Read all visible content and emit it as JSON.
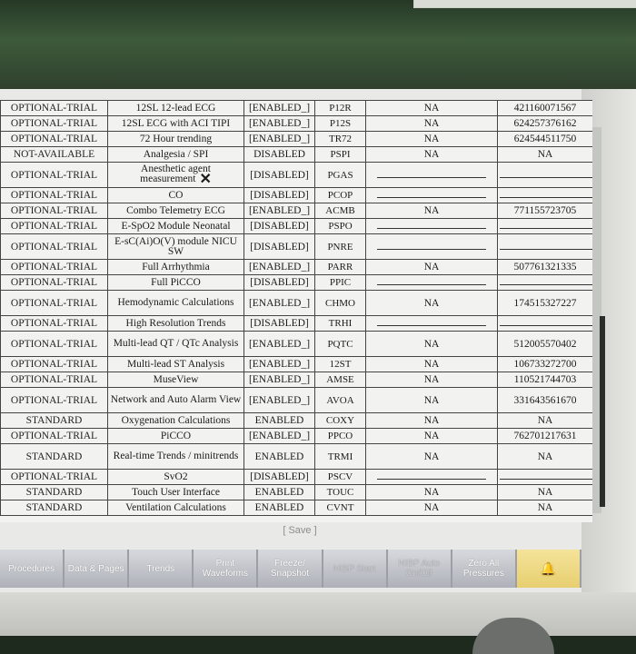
{
  "rows": [
    {
      "status": "OPTIONAL-TRIAL",
      "name": "12SL 12-lead ECG",
      "state": "[ENABLED_]",
      "code": "P12R",
      "na": "NA",
      "key": "421160071567",
      "tall": false
    },
    {
      "status": "OPTIONAL-TRIAL",
      "name": "12SL ECG with ACI TIPI",
      "state": "[ENABLED_]",
      "code": "P12S",
      "na": "NA",
      "key": "624257376162",
      "tall": false
    },
    {
      "status": "OPTIONAL-TRIAL",
      "name": "72 Hour trending",
      "state": "[ENABLED_]",
      "code": "TR72",
      "na": "NA",
      "key": "624544511750",
      "tall": false
    },
    {
      "status": "NOT-AVAILABLE",
      "name": "Analgesia / SPI",
      "state": "DISABLED",
      "code": "PSPI",
      "na": "NA",
      "key": "NA",
      "tall": false
    },
    {
      "status": "OPTIONAL-TRIAL",
      "name": "Anesthetic agent measurement",
      "state": "[DISABLED]",
      "code": "PGAS",
      "na": "",
      "key": "",
      "tall": true,
      "mark": "✕"
    },
    {
      "status": "OPTIONAL-TRIAL",
      "name": "CO",
      "state": "[DISABLED]",
      "code": "PCOP",
      "na": "",
      "key": "",
      "tall": false
    },
    {
      "status": "OPTIONAL-TRIAL",
      "name": "Combo Telemetry ECG",
      "state": "[ENABLED_]",
      "code": "ACMB",
      "na": "NA",
      "key": "771155723705",
      "tall": false
    },
    {
      "status": "OPTIONAL-TRIAL",
      "name": "E-SpO2 Module Neonatal",
      "state": "[DISABLED]",
      "code": "PSPO",
      "na": "",
      "key": "",
      "tall": false
    },
    {
      "status": "OPTIONAL-TRIAL",
      "name": "E-sC(Ai)O(V) module NICU SW",
      "state": "[DISABLED]",
      "code": "PNRE",
      "na": "",
      "key": "",
      "tall": true
    },
    {
      "status": "OPTIONAL-TRIAL",
      "name": "Full Arrhythmia",
      "state": "[ENABLED_]",
      "code": "PARR",
      "na": "NA",
      "key": "507761321335",
      "tall": false
    },
    {
      "status": "OPTIONAL-TRIAL",
      "name": "Full PiCCO",
      "state": "[DISABLED]",
      "code": "PPIC",
      "na": "",
      "key": "",
      "tall": false
    },
    {
      "status": "OPTIONAL-TRIAL",
      "name": "Hemodynamic Calculations",
      "state": "[ENABLED_]",
      "code": "CHMO",
      "na": "NA",
      "key": "174515327227",
      "tall": true
    },
    {
      "status": "OPTIONAL-TRIAL",
      "name": "High Resolution Trends",
      "state": "[DISABLED]",
      "code": "TRHI",
      "na": "",
      "key": "",
      "tall": false
    },
    {
      "status": "OPTIONAL-TRIAL",
      "name": "Multi-lead QT / QTc Analysis",
      "state": "[ENABLED_]",
      "code": "PQTC",
      "na": "NA",
      "key": "512005570402",
      "tall": true
    },
    {
      "status": "OPTIONAL-TRIAL",
      "name": "Multi-lead ST Analysis",
      "state": "[ENABLED_]",
      "code": "12ST",
      "na": "NA",
      "key": "106733272700",
      "tall": false
    },
    {
      "status": "OPTIONAL-TRIAL",
      "name": "MuseView",
      "state": "[ENABLED_]",
      "code": "AMSE",
      "na": "NA",
      "key": "110521744703",
      "tall": false
    },
    {
      "status": "OPTIONAL-TRIAL",
      "name": "Network and Auto Alarm View",
      "state": "[ENABLED_]",
      "code": "AVOA",
      "na": "NA",
      "key": "331643561670",
      "tall": true
    },
    {
      "status": "STANDARD",
      "name": "Oxygenation Calculations",
      "state": "ENABLED",
      "code": "COXY",
      "na": "NA",
      "key": "NA",
      "tall": false
    },
    {
      "status": "OPTIONAL-TRIAL",
      "name": "PiCCO",
      "state": "[ENABLED_]",
      "code": "PPCO",
      "na": "NA",
      "key": "762701217631",
      "tall": false
    },
    {
      "status": "STANDARD",
      "name": "Real-time Trends / minitrends",
      "state": "ENABLED",
      "code": "TRMI",
      "na": "NA",
      "key": "NA",
      "tall": true
    },
    {
      "status": "OPTIONAL-TRIAL",
      "name": "SvO2",
      "state": "[DISABLED]",
      "code": "PSCV",
      "na": "",
      "key": "",
      "tall": false
    },
    {
      "status": "STANDARD",
      "name": "Touch User Interface",
      "state": "ENABLED",
      "code": "TOUC",
      "na": "NA",
      "key": "NA",
      "tall": false
    },
    {
      "status": "STANDARD",
      "name": "Ventilation Calculations",
      "state": "ENABLED",
      "code": "CVNT",
      "na": "NA",
      "key": "NA",
      "tall": false
    }
  ],
  "save_label": "[ Save ]",
  "softkeys": [
    {
      "label": "Procedures",
      "dim": false
    },
    {
      "label": "Data & Pages",
      "dim": false
    },
    {
      "label": "Trends",
      "dim": false
    },
    {
      "label": "Print Waveforms",
      "dim": false
    },
    {
      "label": "Freeze/ Snapshot",
      "dim": false
    },
    {
      "label": "NIBP Start",
      "dim": true
    },
    {
      "label": "NIBP Auto On/Off",
      "dim": true
    },
    {
      "label": "Zero All Pressures",
      "dim": false
    },
    {
      "label": "🔔",
      "dim": false,
      "alarm": true
    }
  ]
}
